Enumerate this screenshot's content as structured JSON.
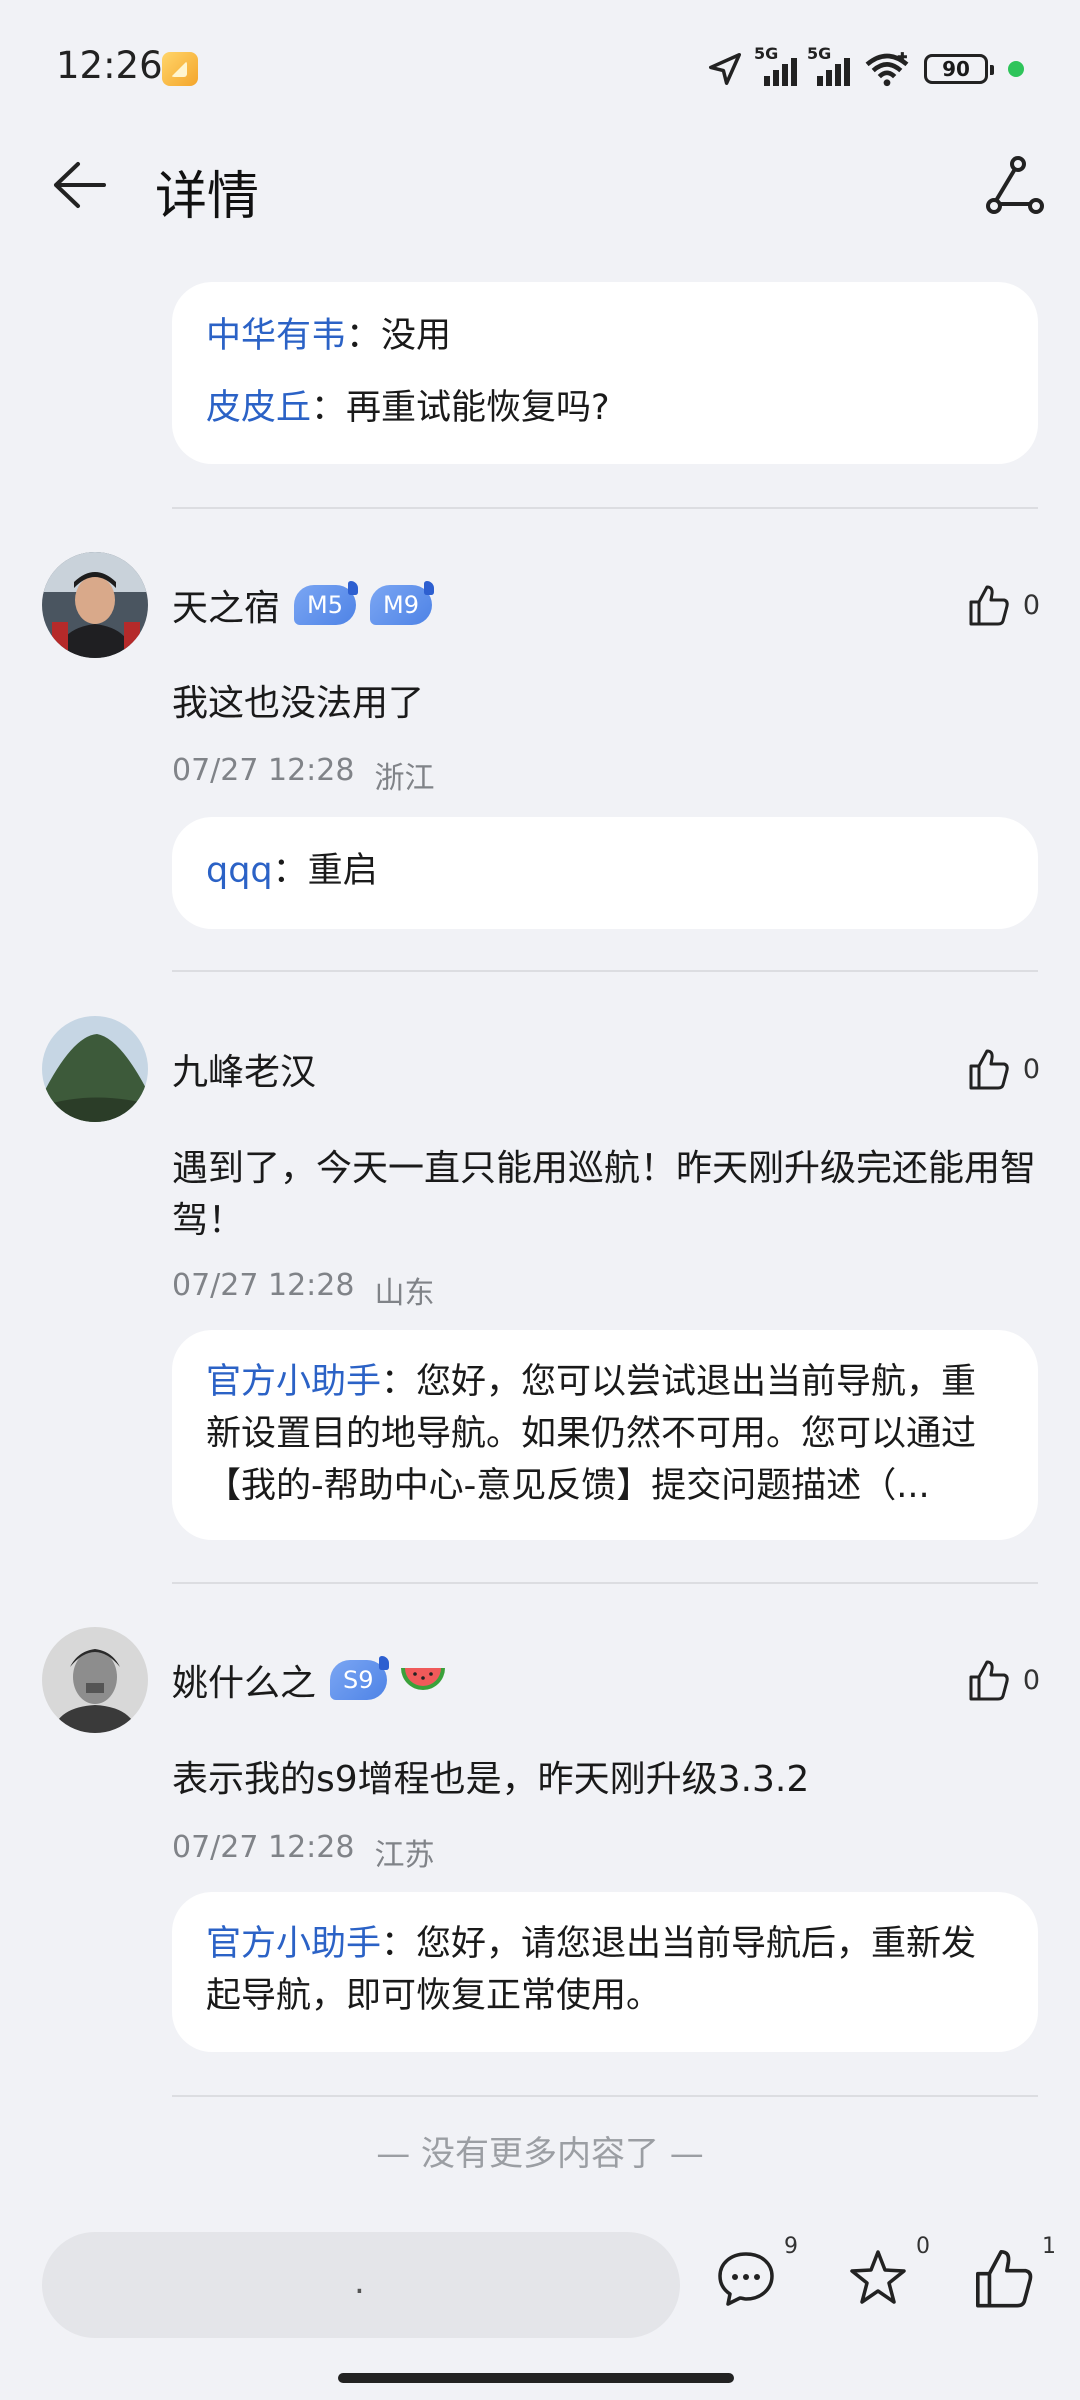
{
  "status_bar": {
    "time": "12:26",
    "network1": "5G",
    "network2": "5G",
    "battery": "90"
  },
  "header": {
    "title": "详情"
  },
  "top_replies": [
    {
      "author": "中华有韦",
      "text": "没用"
    },
    {
      "author": "皮皮丘",
      "text": "再重试能恢复吗?"
    }
  ],
  "comments": [
    {
      "username": "天之宿",
      "badges": [
        "M5",
        "M9"
      ],
      "likes": "0",
      "text": "我这也没法用了",
      "date": "07/27 12:28",
      "location": "浙江",
      "reply": {
        "author": "qqq",
        "text": "重启"
      }
    },
    {
      "username": "九峰老汉",
      "badges": [],
      "likes": "0",
      "text": "遇到了，今天一直只能用巡航！昨天刚升级完还能用智驾！",
      "date": "07/27 12:28",
      "location": "山东",
      "reply": {
        "author": "官方小助手",
        "text": "您好，您可以尝试退出当前导航，重新设置目的地导航。如果仍然不可用。您可以通过【我的-帮助中心-意见反馈】提交问题描述（..."
      }
    },
    {
      "username": "姚什么之",
      "badges": [
        "S9"
      ],
      "likes": "0",
      "text": "表示我的s9增程也是，昨天刚升级3.3.2",
      "date": "07/27 12:28",
      "location": "江苏",
      "reply": {
        "author": "官方小助手",
        "text": "您好，请您退出当前导航后，重新发起导航，即可恢复正常使用。"
      }
    }
  ],
  "reply_colon": "：",
  "end_text": "— 没有更多内容了 —",
  "bottom_bar": {
    "input_placeholder": ".",
    "comment_count": "9",
    "favorite_count": "0",
    "like_count": "1"
  },
  "icons": [
    "back-arrow-icon",
    "share-icon",
    "thumbs-up-icon",
    "comment-icon",
    "star-icon",
    "watermelon-icon"
  ],
  "colors": {
    "background": "#f1f2f6",
    "link_blue": "#2b62c6",
    "badge_blue": "#4e83e6",
    "meta_gray": "#808388"
  }
}
